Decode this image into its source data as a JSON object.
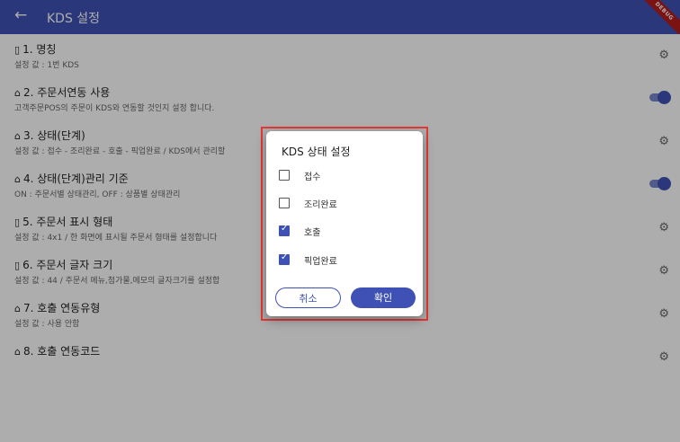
{
  "appbar": {
    "back_icon": "arrow-left-icon",
    "title": "KDS 설정",
    "debug_ribbon": "DEBUG"
  },
  "settings": [
    {
      "icon": "tablet-icon",
      "title": "1. 명칭",
      "subtitle": "설정 값 : 1번 KDS",
      "control": "gear"
    },
    {
      "icon": "home-icon",
      "title": "2. 주문서연동 사용",
      "subtitle": "고객주문POS의 주문이 KDS와 연동할 것인지 설정 합니다.",
      "control": "switch",
      "value": true
    },
    {
      "icon": "home-icon",
      "title": "3. 상태(단계)",
      "subtitle": "설정 값 : 접수 - 조리완료 - 호출 - 픽업완료 / KDS에서 관리할",
      "control": "gear"
    },
    {
      "icon": "home-icon",
      "title": "4. 상태(단계)관리 기준",
      "subtitle": "ON : 주문서별 상태관리, OFF : 상품별 상태관리",
      "control": "switch",
      "value": true
    },
    {
      "icon": "tablet-icon",
      "title": "5. 주문서 표시 형태",
      "subtitle": "설정 값 : 4x1 / 한 화면에 표시될 주문서 형태를 설정합니다",
      "control": "gear"
    },
    {
      "icon": "tablet-icon",
      "title": "6. 주문서 글자 크기",
      "subtitle": "설정 값 : 44 / 주문서 메뉴,첨가물,메모의 글자크기를 설정합",
      "control": "gear"
    },
    {
      "icon": "home-icon",
      "title": "7. 호출 연동유형",
      "subtitle": "설정 값 : 사용 안함",
      "control": "gear"
    },
    {
      "icon": "home-icon",
      "title": "8. 호출 연동코드",
      "subtitle": "",
      "control": "gear"
    }
  ],
  "dialog": {
    "title": "KDS 상태 설정",
    "options": [
      {
        "label": "접수",
        "checked": false
      },
      {
        "label": "조리완료",
        "checked": false
      },
      {
        "label": "호출",
        "checked": true
      },
      {
        "label": "픽업완료",
        "checked": true
      }
    ],
    "cancel_label": "취소",
    "confirm_label": "확인"
  },
  "colors": {
    "primary": "#3f51b5",
    "highlight": "#e53935"
  }
}
